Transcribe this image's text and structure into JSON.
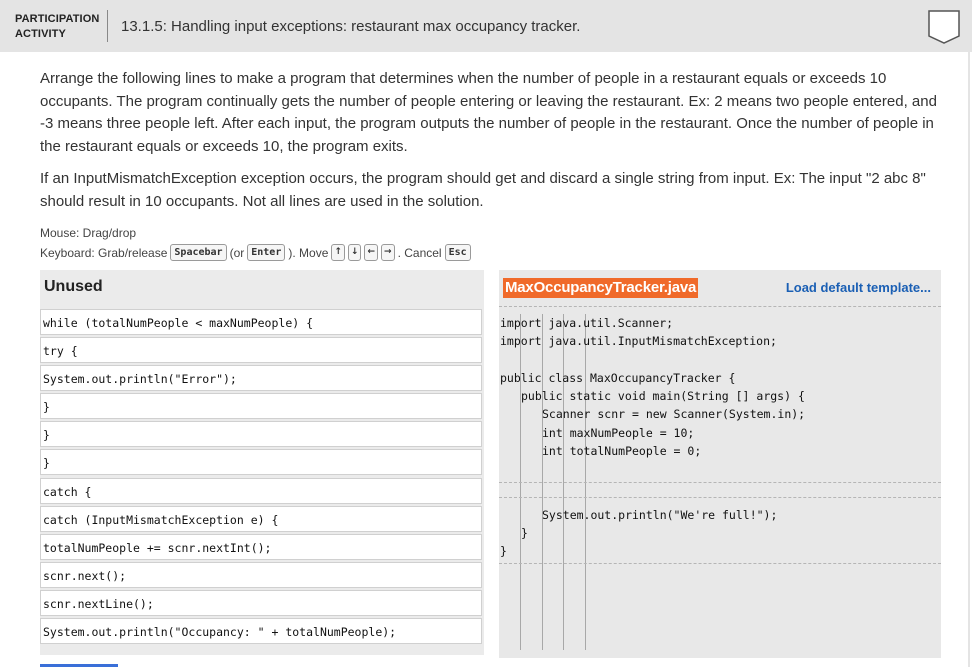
{
  "header": {
    "participation_label": "PARTICIPATION ACTIVITY",
    "activity_title": "13.1.5: Handling input exceptions: restaurant max occupancy tracker."
  },
  "instructions": {
    "paragraph1": "Arrange the following lines to make a program that determines when the number of people in a restaurant equals or exceeds 10 occupants. The program continually gets the number of people entering or leaving the restaurant. Ex: 2 means two people entered, and -3 means three people left. After each input, the program outputs the number of people in the restaurant. Once the number of people in the restaurant equals or exceeds 10, the program exits.",
    "paragraph2": "If an InputMismatchException exception occurs, the program should get and discard a single string from input. Ex: The input \"2 abc 8\" should result in 10 occupants. Not all lines are used in the solution.",
    "mouse_hint": "Mouse: Drag/drop",
    "keyboard_prefix": "Keyboard: Grab/release",
    "spacebar_key": "Spacebar",
    "or_open": "(or",
    "enter_key": "Enter",
    "move_text": "). Move",
    "cancel_text": ". Cancel",
    "esc_key": "Esc",
    "arrow_up": "↑",
    "arrow_down": "↓",
    "arrow_left": "←",
    "arrow_right": "→"
  },
  "unused": {
    "title": "Unused",
    "blocks": [
      "while (totalNumPeople < maxNumPeople) {",
      "try {",
      "System.out.println(\"Error\");",
      "}",
      "}",
      "}",
      "catch {",
      "catch (InputMismatchException e) {",
      "totalNumPeople += scnr.nextInt();",
      "scnr.next();",
      "scnr.nextLine();",
      "System.out.println(\"Occupancy: \" + totalNumPeople);"
    ]
  },
  "file": {
    "name": "MaxOccupancyTracker.java",
    "load_label": "Load default template...",
    "lines": [
      "import java.util.Scanner;",
      "import java.util.InputMismatchException;",
      "public class MaxOccupancyTracker {",
      "public static void main(String [] args) {",
      "Scanner scnr = new Scanner(System.in);",
      "int maxNumPeople = 10;",
      "int totalNumPeople = 0;",
      "System.out.println(\"We're full!\");",
      "}",
      "}"
    ]
  }
}
